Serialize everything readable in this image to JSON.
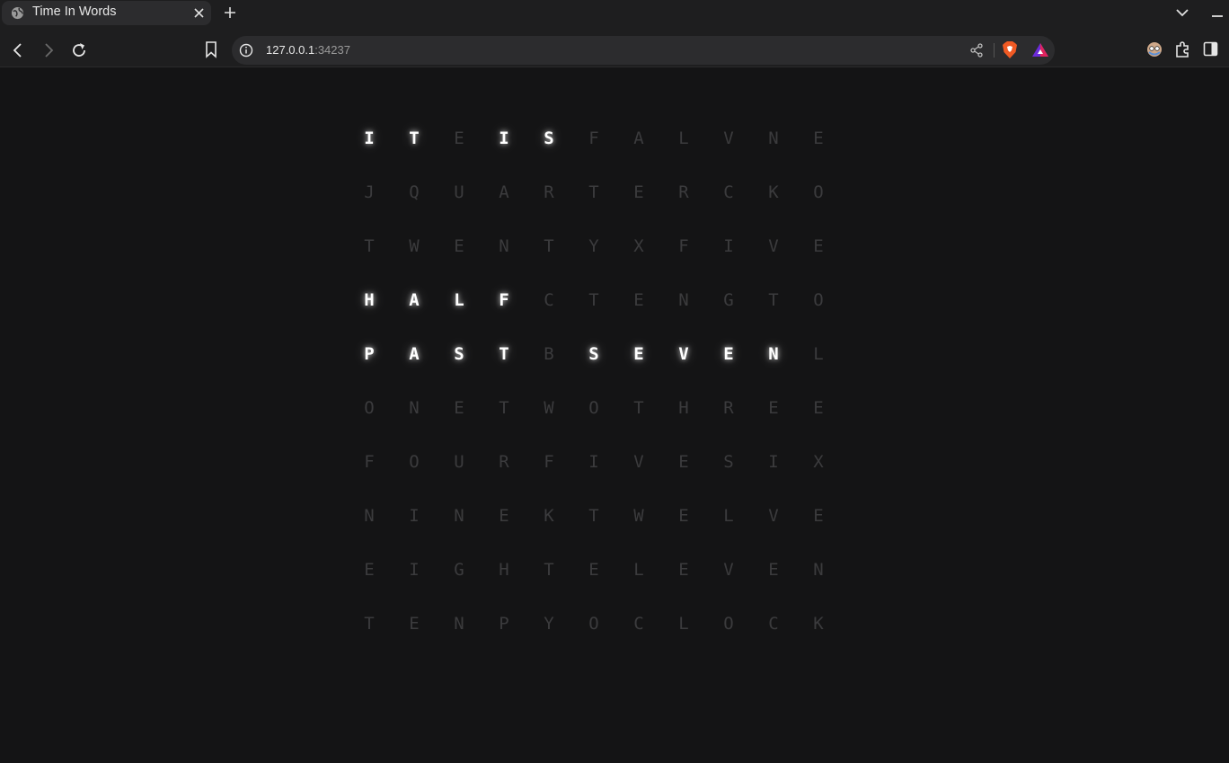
{
  "browser": {
    "tab": {
      "title": "Time In Words"
    },
    "address_bar": {
      "host": "127.0.0.1",
      "port": ":34237"
    }
  },
  "clock": {
    "rows": [
      [
        "I",
        "T",
        "E",
        "I",
        "S",
        "F",
        "A",
        "L",
        "V",
        "N",
        "E"
      ],
      [
        "J",
        "Q",
        "U",
        "A",
        "R",
        "T",
        "E",
        "R",
        "C",
        "K",
        "O"
      ],
      [
        "T",
        "W",
        "E",
        "N",
        "T",
        "Y",
        "X",
        "F",
        "I",
        "V",
        "E"
      ],
      [
        "H",
        "A",
        "L",
        "F",
        "C",
        "T",
        "E",
        "N",
        "G",
        "T",
        "O"
      ],
      [
        "P",
        "A",
        "S",
        "T",
        "B",
        "S",
        "E",
        "V",
        "E",
        "N",
        "L"
      ],
      [
        "O",
        "N",
        "E",
        "T",
        "W",
        "O",
        "T",
        "H",
        "R",
        "E",
        "E"
      ],
      [
        "F",
        "O",
        "U",
        "R",
        "F",
        "I",
        "V",
        "E",
        "S",
        "I",
        "X"
      ],
      [
        "N",
        "I",
        "N",
        "E",
        "K",
        "T",
        "W",
        "E",
        "L",
        "V",
        "E"
      ],
      [
        "E",
        "I",
        "G",
        "H",
        "T",
        "E",
        "L",
        "E",
        "V",
        "E",
        "N"
      ],
      [
        "T",
        "E",
        "N",
        "P",
        "Y",
        "O",
        "C",
        "L",
        "O",
        "C",
        "K"
      ]
    ],
    "lit": [
      [
        0,
        0
      ],
      [
        0,
        1
      ],
      [
        0,
        3
      ],
      [
        0,
        4
      ],
      [
        3,
        0
      ],
      [
        3,
        1
      ],
      [
        3,
        2
      ],
      [
        3,
        3
      ],
      [
        4,
        0
      ],
      [
        4,
        1
      ],
      [
        4,
        2
      ],
      [
        4,
        3
      ],
      [
        4,
        5
      ],
      [
        4,
        6
      ],
      [
        4,
        7
      ],
      [
        4,
        8
      ],
      [
        4,
        9
      ]
    ],
    "colors": {
      "lit": "#ffffff",
      "dim": "#3b3b3d",
      "background": "#141415"
    }
  }
}
